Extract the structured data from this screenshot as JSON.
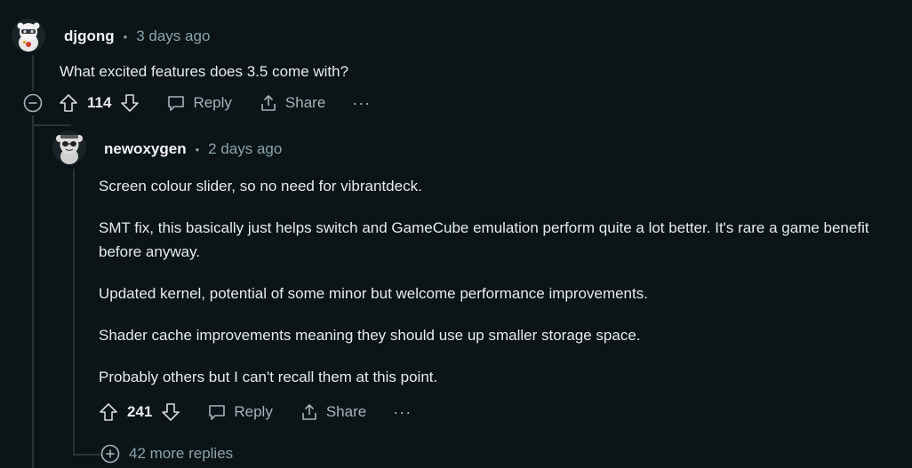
{
  "comments": [
    {
      "username": "djgong",
      "separator": "•",
      "timestamp": "3 days ago",
      "avatar_icon": "snoo-avatar-icon",
      "body": [
        "What excited features does 3.5 come with?"
      ],
      "score": "114",
      "reply_label": "Reply",
      "share_label": "Share",
      "more_label": "···"
    },
    {
      "username": "newoxygen",
      "separator": "•",
      "timestamp": "2 days ago",
      "avatar_icon": "snoo-avatar-icon",
      "body": [
        "Screen colour slider, so no need for vibrantdeck.",
        "SMT fix, this basically just helps switch and GameCube emulation perform quite a lot better. It's rare a game benefit before anyway.",
        "Updated kernel, potential of some minor but welcome performance improvements.",
        "Shader cache improvements meaning they should use up smaller storage space.",
        "Probably others but I can't recall them at this point."
      ],
      "score": "241",
      "reply_label": "Reply",
      "share_label": "Share",
      "more_label": "···"
    }
  ],
  "more_replies_label": "42 more replies",
  "colors": {
    "background": "#0b1416",
    "text": "#e8eaec",
    "muted": "#8ba2ad",
    "thread_line": "#2a3236"
  }
}
